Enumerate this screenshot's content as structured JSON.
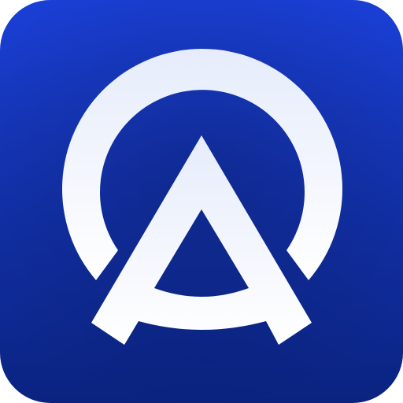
{
  "app_icon": {
    "name": "app-logo-icon",
    "colors": {
      "background_top": "#1a3fd6",
      "background_bottom": "#0a2380",
      "glyph_top": "#e6ecfb",
      "glyph_bottom": "#ffffff"
    }
  }
}
